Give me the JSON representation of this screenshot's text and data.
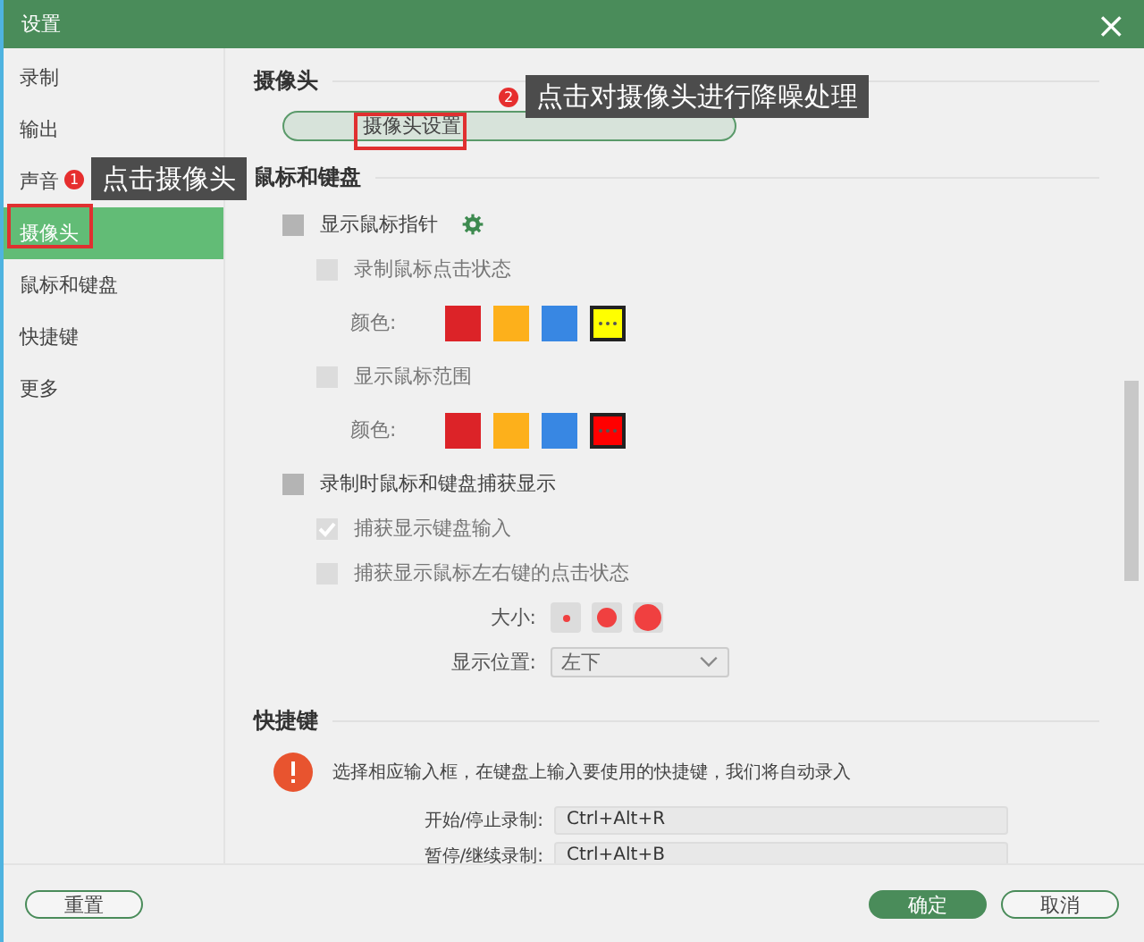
{
  "window": {
    "title": "设置",
    "close": "×"
  },
  "sidebar": {
    "items": [
      {
        "label": "录制",
        "selected": false
      },
      {
        "label": "输出",
        "selected": false
      },
      {
        "label": "声音",
        "selected": false
      },
      {
        "label": "摄像头",
        "selected": true
      },
      {
        "label": "鼠标和键盘",
        "selected": false
      },
      {
        "label": "快捷键",
        "selected": false
      },
      {
        "label": "更多",
        "selected": false
      }
    ]
  },
  "camera": {
    "title": "摄像头",
    "button": "摄像头设置"
  },
  "mouse": {
    "title": "鼠标和键盘",
    "pointer": {
      "label": "显示鼠标指针",
      "checked": false
    },
    "click_state": {
      "label": "录制鼠标点击状态",
      "checked": false,
      "color_label": "颜色:",
      "swatches": [
        {
          "color": "#dc2328",
          "selected": false
        },
        {
          "color": "#fdb01b",
          "selected": false
        },
        {
          "color": "#3887e3",
          "selected": false
        },
        {
          "color": "#ffff00",
          "selected": true
        }
      ]
    },
    "range": {
      "label": "显示鼠标范围",
      "checked": false,
      "color_label": "颜色:",
      "swatches": [
        {
          "color": "#dc2328",
          "selected": false
        },
        {
          "color": "#fdb01b",
          "selected": false
        },
        {
          "color": "#3887e3",
          "selected": false
        },
        {
          "color": "#ff0000",
          "selected": true
        }
      ]
    },
    "capture": {
      "label": "录制时鼠标和键盘捕获显示",
      "checked": false
    },
    "keyboard_input": {
      "label": "捕获显示键盘输入",
      "checked": true
    },
    "mouse_clicks": {
      "label": "捕获显示鼠标左右键的点击状态",
      "checked": false
    },
    "size_label": "大小:",
    "position_label": "显示位置:",
    "position": "左下"
  },
  "shortcuts": {
    "title": "快捷键",
    "info": "选择相应输入框，在键盘上输入要使用的快捷键，我们将自动录入",
    "rows": [
      {
        "label": "开始/停止录制:",
        "value": "Ctrl+Alt+R"
      },
      {
        "label": "暂停/继续录制:",
        "value": "Ctrl+Alt+B"
      }
    ]
  },
  "footer": {
    "reset": "重置",
    "ok": "确定",
    "cancel": "取消"
  },
  "annotations": [
    {
      "badge": "1",
      "text": "点击摄像头"
    },
    {
      "badge": "2",
      "text": "点击对摄像头进行降噪处理"
    }
  ]
}
